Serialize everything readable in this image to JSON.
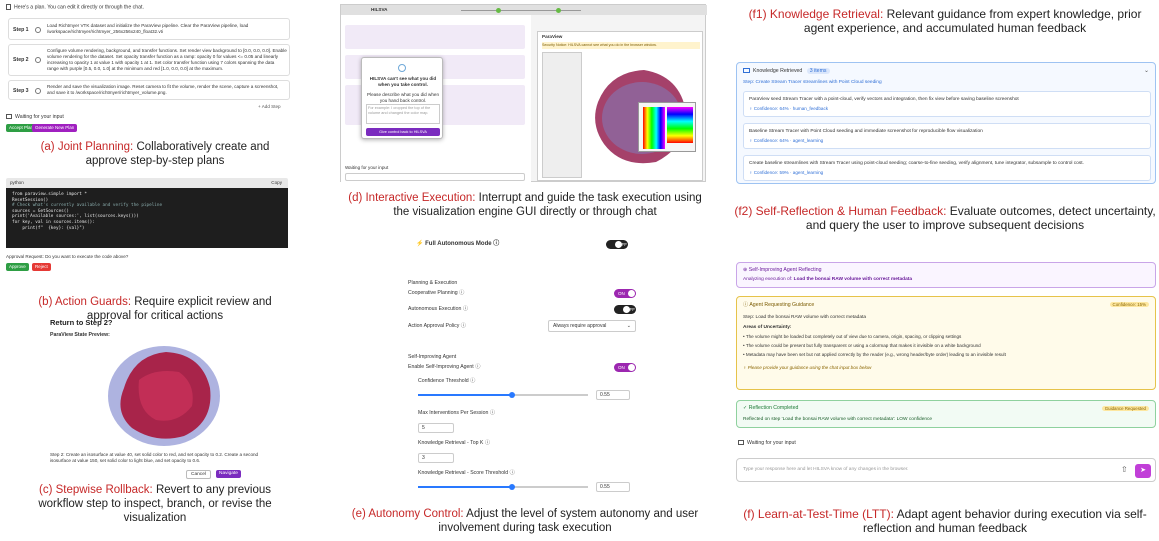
{
  "a": {
    "intro": "Here's a plan. You can edit it directly or through the chat.",
    "steps": [
      {
        "label": "Step 1",
        "text": "Load Richtmyer VTK dataset and initialize the ParaView pipeline. Clear the ParaView pipeline, load /workspace/richtmyer/richtmyer_256x256x240_float32.vti"
      },
      {
        "label": "Step 2",
        "text": "Configure volume rendering, background, and transfer functions. Set render view background to [0.0, 0.0, 0.0]. Enable volume rendering for the dataset. Set opacity transfer function as a ramp: opacity 0 for values <= 0.05 and linearly increasing to opacity 1 at value 1 with opacity 1 at 1. Set color transfer function using 7 colors spanning the data range with purple [0.5, 0.0, 1.0] at the minimum and red [1.0, 0.0, 0.0] at the maximum."
      },
      {
        "label": "Step 3",
        "text": "Render and save the visualization image. Reset camera to fit the volume, render the scene, capture a screenshot, and save it to /workspace/richtmyer/richtmyer_volume.png."
      }
    ],
    "add_step": "+ Add Step",
    "waiting": "Waiting for your input",
    "accept": "Accept Plan",
    "generate": "Generate New Plan",
    "cap_lead": "(a) Joint Planning:",
    "cap_rest": " Collaboratively create and approve step-by-step plans"
  },
  "b": {
    "lang": "python",
    "copy": "Copy",
    "code": [
      "from paraview.simple import *",
      "ResetSession()",
      "",
      "# Check what's currently available and verify the pipeline",
      "sources = GetSources()",
      "print('Available sources:', list(sources.keys()))",
      "for key, val in sources.items():",
      "    print(f\"  {key}: {val}\")"
    ],
    "approval": "Approval Request: Do you want to execute the code above?",
    "approve": "Approve",
    "reject": "Reject",
    "cap_lead": "(b) Action Guards:",
    "cap_rest": " Require explicit review and approval for critical actions"
  },
  "c": {
    "title": "Return to Step 2?",
    "preview": "ParaView State Preview:",
    "desc": "Step 2: Create an isosurface at value 40, set solid color to red, and set opacity to 0.2. Create a second isosurface at value 150, set solid color to light blue, and set opacity to 0.6.",
    "cancel": "Cancel",
    "navigate": "Navigate",
    "cap_lead": "(c) Stepwise Rollback:",
    "cap_rest": " Revert to any previous workflow step to inspect, branch, or revise the visualization"
  },
  "d": {
    "app": "HILSVA",
    "dialog_title": "HILSVA can't see what you did when you take control.",
    "dialog_body": "Please describe what you did when you hand back control.",
    "dialog_ph": "For example: I cropped the top of the volume and changed the color map.",
    "dialog_btn": "Give control back to HILSVA",
    "panel": "ParaView",
    "warn": "Security Notice: HILSVA cannot see what you do in the browser window.",
    "waiting": "Waiting for your input",
    "cap_lead": "(d) Interactive Execution:",
    "cap_rest": " Interrupt and guide the task execution using the visualization engine GUI directly or through chat"
  },
  "e": {
    "auto_mode": "Full Autonomous Mode",
    "sec1": "Planning & Execution",
    "coop": "Cooperative Planning",
    "auton": "Autonomous Execution",
    "policy": "Action Approval Policy",
    "policy_val": "Always require approval",
    "sec2": "Self-Improving Agent",
    "enable": "Enable Self-Improving Agent",
    "conf": "Confidence Threshold",
    "conf_val": "0.55",
    "maxint": "Max Interventions Per Session",
    "maxint_val": "5",
    "topk": "Knowledge Retrieval - Top K",
    "topk_val": "3",
    "score": "Knowledge Retrieval - Score Threshold",
    "score_val": "0.55",
    "on": "ON",
    "off": "OFF",
    "cap_lead": "(e) Autonomy Control:",
    "cap_rest": " Adjust the level of system autonomy and user involvement during task execution"
  },
  "f1": {
    "cap_lead": "(f1) Knowledge Retrieval:",
    "cap_rest": " Relevant guidance from expert knowledge, prior agent experience, and accumulated human feedback",
    "title": "Knowledge Retrieved",
    "badge": "3 items",
    "step": "Step: Create Stream Tracer streamlines with Point Cloud seeding",
    "items": [
      {
        "text": "ParaView seed Stream Tracer with a point-cloud, verify vectors and integration, then fix view before saving baseline screenshot",
        "meta": "Confidence: 64%  ·  human_feedback"
      },
      {
        "text": "Baseline Stream Tracer with Point Cloud seeding and immediate screenshot for reproducible flow visualization",
        "meta": "Confidence: 64%  ·  agent_learning"
      },
      {
        "text": "Create baseline streamlines with Stream Tracer using point-cloud seeding; coarse-to-fine seeding, verify alignment, tune integrator, subsample to control cost.",
        "meta": "Confidence: 59%  ·  agent_learning"
      }
    ]
  },
  "f2": {
    "cap_lead": "(f2) Self-Reflection & Human Feedback:",
    "cap_rest": " Evaluate outcomes, detect uncertainty, and query the user to improve subsequent decisions"
  },
  "f": {
    "reflect_title": "Self-Improving Agent Reflecting",
    "reflect_sub_pre": "Analyzing execution of: ",
    "reflect_sub": "Load the bonsai RAW volume with correct metadata",
    "guid_title": "Agent Requesting Guidance",
    "guid_badge": "Confidence: 15%",
    "guid_step": "Step: Load the bonsai RAW volume with correct metadata",
    "guid_areas": "Areas of Uncertainty:",
    "bullets": [
      "The volume might be loaded but completely out of view due to camera, origin, spacing, or clipping settings",
      "The volume could be present but fully transparent or using a colormap that makes it invisible on a white background",
      "Metadata may have been set but not applied correctly by the reader (e.g., wrong header/byte order) leading to an invisible result"
    ],
    "guid_hint": "Please provide your guidance using the chat input box below",
    "done_title": "Reflection Completed",
    "done_badge": "Guidance Requested",
    "done_body": "Reflected on step 'Load the bonsai RAW volume with correct metadata': LOW confidence",
    "waiting": "Waiting for your input",
    "input_ph": "Type your response here and let HILSVA know of any changes in the browser.",
    "cap_lead": "(f) Learn-at-Test-Time (LTT):",
    "cap_rest": " Adapt agent behavior during execution via self-reflection and human feedback"
  }
}
